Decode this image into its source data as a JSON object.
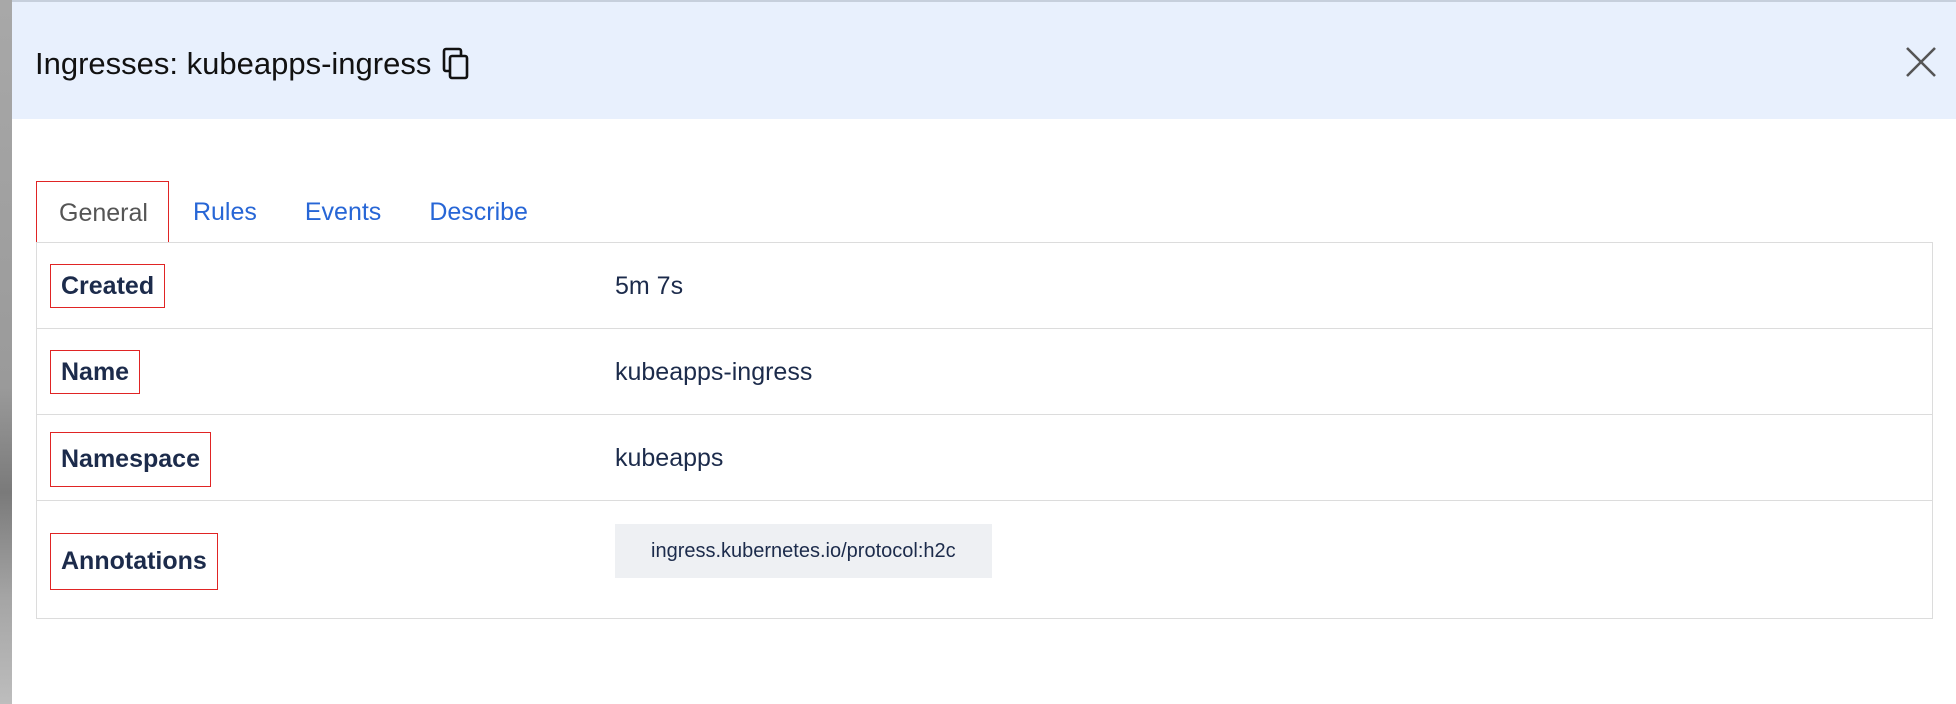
{
  "header": {
    "title": "Ingresses: kubeapps-ingress",
    "background": "#e8f0fd",
    "copy_icon": "copy-icon",
    "close_icon": "close-icon"
  },
  "tabs": [
    {
      "label": "General",
      "active": true
    },
    {
      "label": "Rules",
      "active": false
    },
    {
      "label": "Events",
      "active": false
    },
    {
      "label": "Describe",
      "active": false
    }
  ],
  "details": {
    "rows": [
      {
        "key": "Created",
        "value": "5m 7s"
      },
      {
        "key": "Name",
        "value": "kubeapps-ingress"
      },
      {
        "key": "Namespace",
        "value": "kubeapps"
      },
      {
        "key": "Annotations",
        "tags": [
          "ingress.kubernetes.io/protocol:h2c"
        ]
      }
    ]
  },
  "colors": {
    "link": "#2766d6",
    "highlight_border": "#e02424",
    "text_dark": "#1c2b4b"
  }
}
